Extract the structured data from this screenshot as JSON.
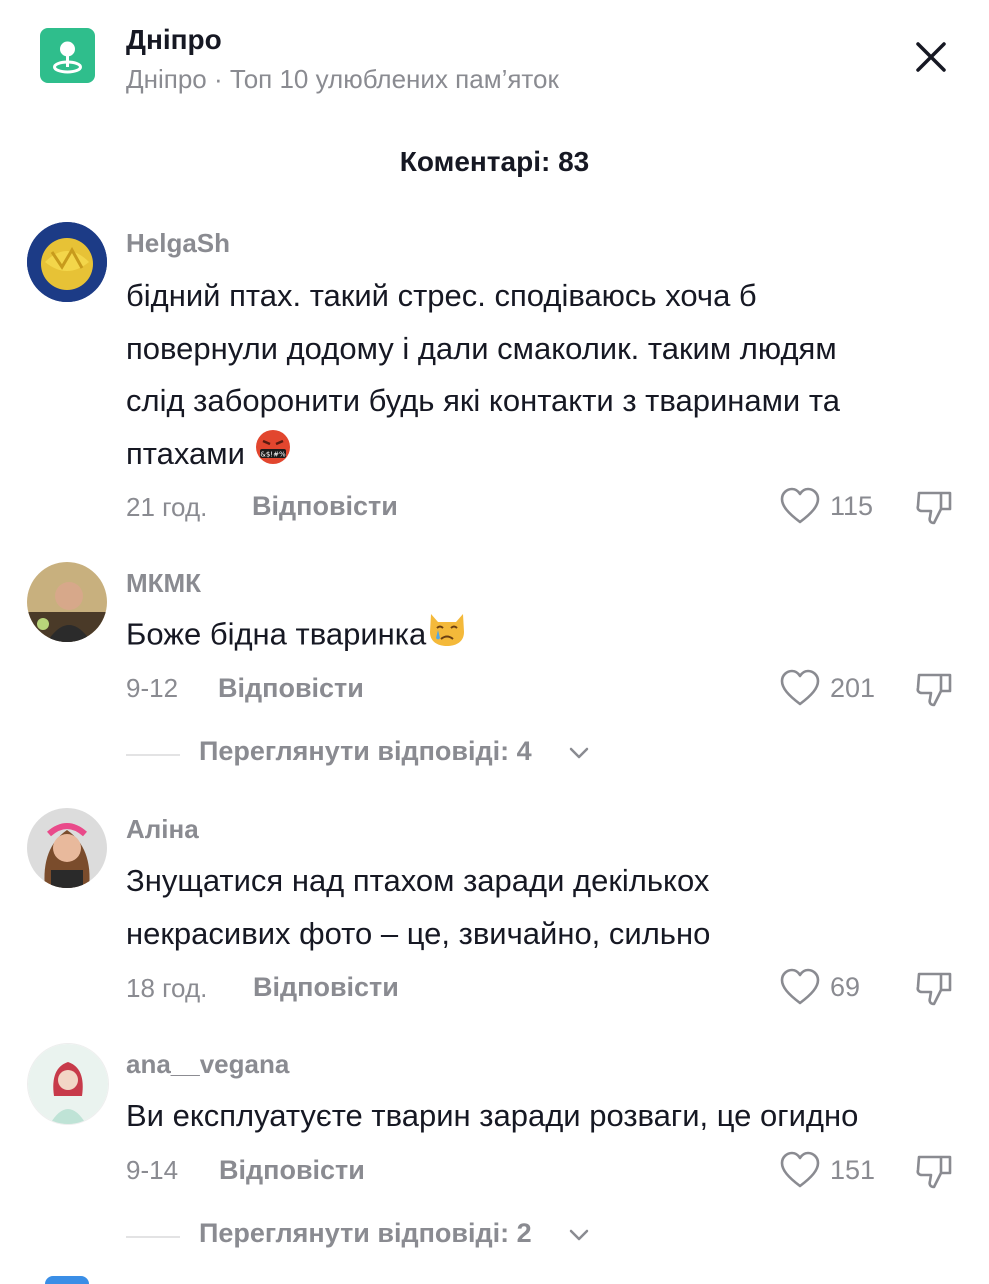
{
  "header": {
    "title": "Дніпро",
    "subtitle": "Дніпро · Топ 10 улюблених пам’яток",
    "icon": "location-pin-icon",
    "accent_color": "#2fbe8c"
  },
  "comments_title": "Коментарі: 83",
  "comments": [
    {
      "username": "HelgaSh",
      "text_lines": [
        "бідний птах. такий стрес. сподіваюсь хоча б",
        "повернули додому і дали смаколик. таким людям",
        "слід заборонити будь які контакти з тваринами та",
        "птахами"
      ],
      "emoji": "face-with-symbols-on-mouth",
      "time": "21 год.",
      "reply_label": "Відповісти",
      "likes": "115"
    },
    {
      "username": "МКМК",
      "text_lines": [
        "Боже бідна тваринка"
      ],
      "emoji": "crying-cat-face",
      "time": "9-12",
      "reply_label": "Відповісти",
      "likes": "201",
      "view_replies": "Переглянути відповіді: 4"
    },
    {
      "username": "Аліна",
      "text_lines": [
        "Знущатися над птахом заради декількох",
        "некрасивих фото – це, звичайно, сильно"
      ],
      "time": "18 год.",
      "reply_label": "Відповісти",
      "likes": "69"
    },
    {
      "username": "ana__vegana",
      "text_lines": [
        "Ви експлуатуєте тварин заради розваги, це огидно"
      ],
      "time": "9-14",
      "reply_label": "Відповісти",
      "likes": "151",
      "view_replies": "Переглянути відповіді: 2"
    }
  ]
}
